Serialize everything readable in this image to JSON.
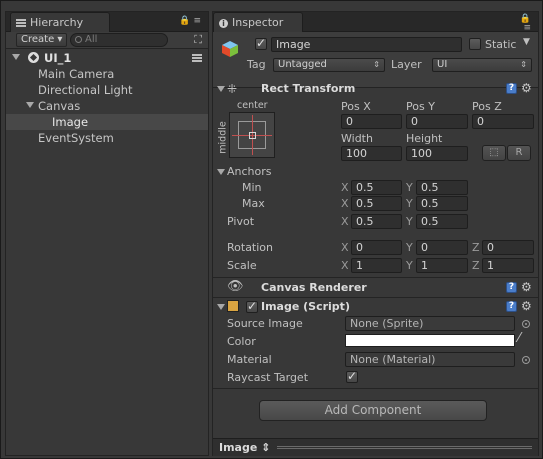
{
  "hierarchy": {
    "tab_label": "Hierarchy",
    "create_label": "Create",
    "search_placeholder": "All",
    "scene_name": "UI_1",
    "items": [
      {
        "label": "Main Camera"
      },
      {
        "label": "Directional Light"
      },
      {
        "label": "Canvas"
      },
      {
        "label": "Image"
      },
      {
        "label": "EventSystem"
      }
    ]
  },
  "inspector": {
    "tab_label": "Inspector",
    "object_name": "Image",
    "static_label": "Static",
    "tag_label": "Tag",
    "tag_value": "Untagged",
    "layer_label": "Layer",
    "layer_value": "UI",
    "rect_transform": {
      "title": "Rect Transform",
      "anchor_h": "center",
      "anchor_v": "middle",
      "pos_x_label": "Pos X",
      "pos_y_label": "Pos Y",
      "pos_z_label": "Pos Z",
      "pos_x": "0",
      "pos_y": "0",
      "pos_z": "0",
      "width_label": "Width",
      "height_label": "Height",
      "width": "100",
      "height": "100",
      "raw_button": "R",
      "anchors_label": "Anchors",
      "min_label": "Min",
      "min_x": "0.5",
      "min_y": "0.5",
      "max_label": "Max",
      "max_x": "0.5",
      "max_y": "0.5",
      "pivot_label": "Pivot",
      "pivot_x": "0.5",
      "pivot_y": "0.5",
      "rotation_label": "Rotation",
      "rot_x": "0",
      "rot_y": "0",
      "rot_z": "0",
      "scale_label": "Scale",
      "scale_x": "1",
      "scale_y": "1",
      "scale_z": "1",
      "x": "X",
      "y": "Y",
      "z": "Z"
    },
    "canvas_renderer": {
      "title": "Canvas Renderer"
    },
    "image_script": {
      "title": "Image (Script)",
      "source_image_label": "Source Image",
      "source_image_value": "None (Sprite)",
      "color_label": "Color",
      "color_value": "#ffffff",
      "material_label": "Material",
      "material_value": "None (Material)",
      "raycast_label": "Raycast Target",
      "raycast_checked": true
    },
    "add_component_label": "Add Component",
    "footer_label": "Image ⇕"
  }
}
